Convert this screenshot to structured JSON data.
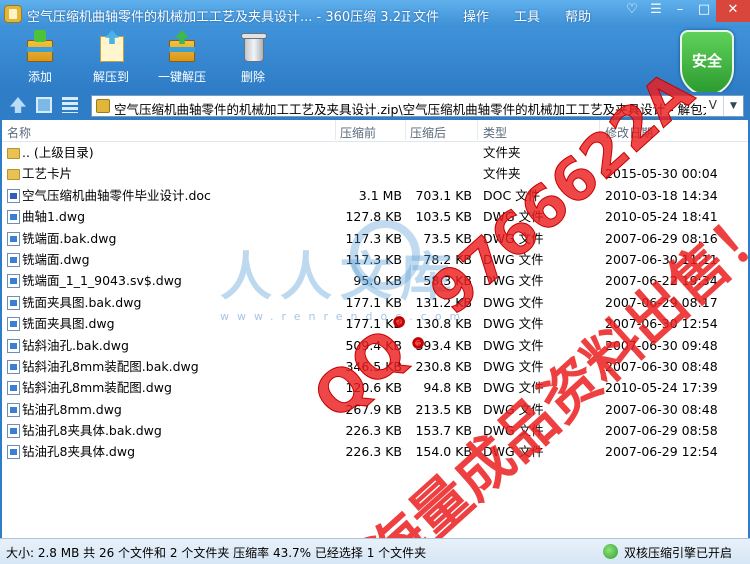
{
  "titlebar": {
    "title": "空气压缩机曲轴零件的机械加工工艺及夹具设计... - 360压缩 3.2正式版",
    "menu": [
      "文件",
      "操作",
      "工具",
      "帮助"
    ]
  },
  "toolbar": {
    "add_label": "添加",
    "extract_label": "解压到",
    "one_click_label": "一键解压",
    "delete_label": "删除",
    "security_badge": "安全"
  },
  "address": {
    "path": "空气压缩机曲轴零件的机械加工工艺及夹具设计.zip\\空气压缩机曲轴零件的机械加工工艺及夹具设计 - 解包大",
    "suffix": "V"
  },
  "columns": {
    "name": "名称",
    "original": "压缩前",
    "compressed": "压缩后",
    "type": "类型",
    "modified": "修改日期"
  },
  "files": [
    {
      "icon": "folder",
      "name": ".. (上级目录)",
      "orig": "",
      "comp": "",
      "type": "文件夹",
      "date": ""
    },
    {
      "icon": "folder",
      "name": "工艺卡片",
      "orig": "",
      "comp": "",
      "type": "文件夹",
      "date": "2015-05-30 00:04"
    },
    {
      "icon": "doc",
      "name": "空气压缩机曲轴零件毕业设计.doc",
      "orig": "3.1 MB",
      "comp": "703.1 KB",
      "type": "DOC 文件",
      "date": "2010-03-18 14:34"
    },
    {
      "icon": "dwg",
      "name": "曲轴1.dwg",
      "orig": "127.8 KB",
      "comp": "103.5 KB",
      "type": "DWG 文件",
      "date": "2010-05-24 18:41"
    },
    {
      "icon": "dwg",
      "name": "铣端面.bak.dwg",
      "orig": "117.3 KB",
      "comp": "73.5 KB",
      "type": "DWG 文件",
      "date": "2007-06-29 08:16"
    },
    {
      "icon": "dwg",
      "name": "铣端面.dwg",
      "orig": "117.3 KB",
      "comp": "78.2 KB",
      "type": "DWG 文件",
      "date": "2007-06-30 11:11"
    },
    {
      "icon": "dwg",
      "name": "铣端面_1_1_9043.sv$.dwg",
      "orig": "95.0 KB",
      "comp": "58.3 KB",
      "type": "DWG 文件",
      "date": "2007-06-22 19:34"
    },
    {
      "icon": "dwg",
      "name": "铣面夹具图.bak.dwg",
      "orig": "177.1 KB",
      "comp": "131.2 KB",
      "type": "DWG 文件",
      "date": "2007-06-29 08:17"
    },
    {
      "icon": "dwg",
      "name": "铣面夹具图.dwg",
      "orig": "177.1 KB",
      "comp": "130.8 KB",
      "type": "DWG 文件",
      "date": "2007-06-30 12:54"
    },
    {
      "icon": "dwg",
      "name": "钻斜油孔.bak.dwg",
      "orig": "509.4 KB",
      "comp": "393.4 KB",
      "type": "DWG 文件",
      "date": "2007-06-30 09:48"
    },
    {
      "icon": "dwg",
      "name": "钻斜油孔8mm装配图.bak.dwg",
      "orig": "346.5 KB",
      "comp": "230.8 KB",
      "type": "DWG 文件",
      "date": "2007-06-30 08:48"
    },
    {
      "icon": "dwg",
      "name": "钻斜油孔8mm装配图.dwg",
      "orig": "120.6 KB",
      "comp": "94.8 KB",
      "type": "DWG 文件",
      "date": "2010-05-24 17:39"
    },
    {
      "icon": "dwg",
      "name": "钻油孔8mm.dwg",
      "orig": "267.9 KB",
      "comp": "213.5 KB",
      "type": "DWG 文件",
      "date": "2007-06-30 08:48"
    },
    {
      "icon": "dwg",
      "name": "钻油孔8夹具体.bak.dwg",
      "orig": "226.3 KB",
      "comp": "153.7 KB",
      "type": "DWG 文件",
      "date": "2007-06-29 08:58"
    },
    {
      "icon": "dwg",
      "name": "钻油孔8夹具体.dwg",
      "orig": "226.3 KB",
      "comp": "154.0 KB",
      "type": "DWG 文件",
      "date": "2007-06-29 12:54"
    }
  ],
  "watermark": {
    "logo_text": "人人文库",
    "logo_url": "www.renrendoc.com",
    "qq_text": "QQ：9766622A",
    "sell_text": "海量成品资料出售！"
  },
  "status": {
    "summary": "大小: 2.8 MB 共 26 个文件和 2 个文件夹 压缩率 43.7% 已经选择 1 个文件夹",
    "engine": "双核压缩引擎已开启"
  }
}
